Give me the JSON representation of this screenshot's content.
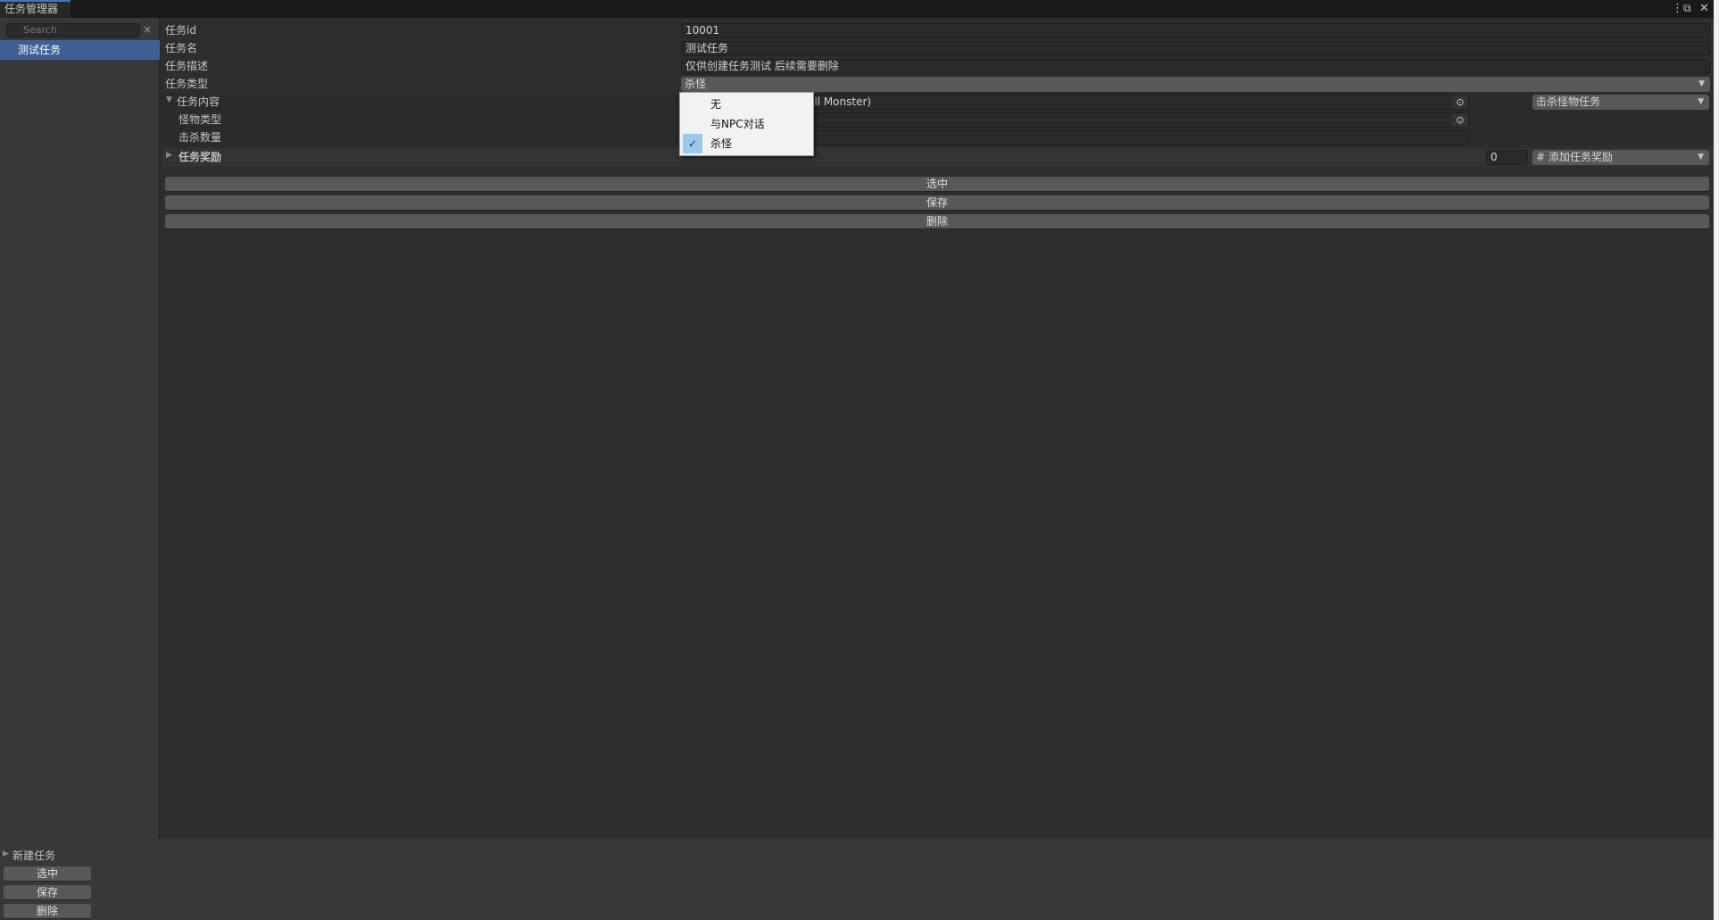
{
  "window": {
    "tab_title": "任务管理器",
    "menu_icon": "kebab-menu-icon",
    "maximize_icon": "maximize-icon",
    "close_icon": "close-icon"
  },
  "sidebar": {
    "search_placeholder": "Search",
    "items": [
      {
        "label": "测试任务",
        "selected": true
      }
    ]
  },
  "form": {
    "id_label": "任务id",
    "id_value": "10001",
    "name_label": "任务名",
    "name_value": "测试任务",
    "desc_label": "任务描述",
    "desc_value": "仅供创建任务测试 后续需要删除",
    "type_label": "任务类型",
    "type_value": "杀怪",
    "content_label": "任务内容",
    "content_value": "ill Monster)",
    "content_type": "击杀怪物任务",
    "monster_type_label": "怪物类型",
    "kill_count_label": "击杀数量",
    "reward_label": "任务奖励",
    "reward_count": "0",
    "reward_add": "# 添加任务奖励"
  },
  "type_dropdown": {
    "options": [
      "无",
      "与NPC对话",
      "杀怪"
    ],
    "selected": "杀怪"
  },
  "actions": {
    "select": "选中",
    "save": "保存",
    "delete": "删除"
  },
  "bottom": {
    "new_task": "新建任务",
    "select": "选中",
    "save": "保存",
    "delete": "删除"
  },
  "colors": {
    "selection": "#3e5f96",
    "tab_accent": "#3a79bb",
    "check_highlight": "#99c9ef"
  }
}
